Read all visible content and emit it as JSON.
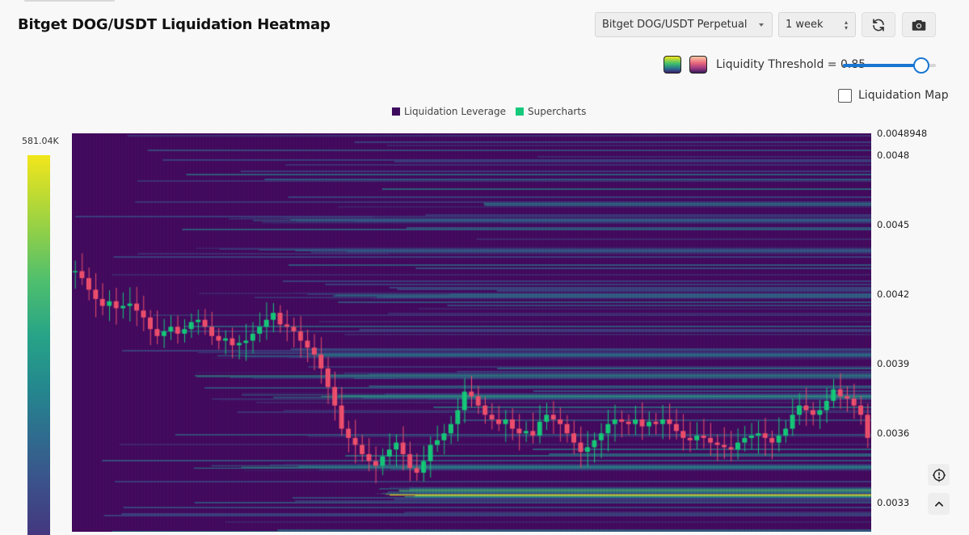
{
  "header": {
    "title": "Bitget DOG/USDT Liquidation Heatmap"
  },
  "controls": {
    "exchange_select": "Bitget DOG/USDT Perpetual",
    "range_select": "1 week",
    "refresh_icon": "refresh-icon",
    "camera_icon": "camera-icon",
    "threshold_label": "Liquidity Threshold = 0.85",
    "threshold_value": 0.85,
    "liquidation_map_label": "Liquidation Map",
    "liquidation_map_checked": false
  },
  "colorscales": [
    "viridis",
    "magma"
  ],
  "legend": [
    {
      "label": "Liquidation Leverage",
      "color": "#3d0b5e"
    },
    {
      "label": "Supercharts",
      "color": "#16c97a"
    }
  ],
  "colorbar": {
    "max_label": "581.04K"
  },
  "chart_data": {
    "type": "heatmap",
    "y_ticks": [
      "0.0048948",
      "0.0048",
      "0.0045",
      "0.0042",
      "0.0039",
      "0.0036",
      "0.0033"
    ],
    "y_range": [
      0.0031,
      0.0048948
    ],
    "price_candles_close": [
      0.0043,
      0.00427,
      0.00422,
      0.00418,
      0.00415,
      0.00417,
      0.00414,
      0.00415,
      0.00416,
      0.00413,
      0.0041,
      0.00405,
      0.00402,
      0.00404,
      0.00406,
      0.00403,
      0.00405,
      0.00408,
      0.00409,
      0.00406,
      0.00402,
      0.004,
      0.00401,
      0.00398,
      0.00399,
      0.004,
      0.00403,
      0.00406,
      0.00409,
      0.00412,
      0.00407,
      0.00406,
      0.00404,
      0.004,
      0.00397,
      0.00394,
      0.00388,
      0.0038,
      0.00372,
      0.00362,
      0.00358,
      0.00355,
      0.00351,
      0.00348,
      0.00346,
      0.0035,
      0.00353,
      0.00356,
      0.00351,
      0.00345,
      0.00343,
      0.00348,
      0.00355,
      0.00357,
      0.0036,
      0.00364,
      0.0037,
      0.00378,
      0.00376,
      0.00372,
      0.00368,
      0.00366,
      0.00364,
      0.00366,
      0.00362,
      0.0036,
      0.00361,
      0.00359,
      0.00365,
      0.00368,
      0.00366,
      0.00364,
      0.0036,
      0.00356,
      0.00352,
      0.00354,
      0.00357,
      0.0036,
      0.00364,
      0.00366,
      0.00365,
      0.00364,
      0.00366,
      0.00363,
      0.00365,
      0.00364,
      0.00366,
      0.00364,
      0.00361,
      0.00358,
      0.00357,
      0.00359,
      0.00358,
      0.00356,
      0.00355,
      0.00354,
      0.00353,
      0.00356,
      0.00358,
      0.00359,
      0.0036,
      0.00358,
      0.00356,
      0.00359,
      0.00362,
      0.00368,
      0.00372,
      0.0037,
      0.00368,
      0.0037,
      0.00374,
      0.00379,
      0.00376,
      0.00375,
      0.00372,
      0.00368,
      0.00358
    ],
    "high_liquidity_levels": [
      {
        "price": 0.003335,
        "intensity": 1.0
      },
      {
        "price": 0.003355,
        "intensity": 0.75
      },
      {
        "price": 0.003455,
        "intensity": 0.55
      },
      {
        "price": 0.00376,
        "intensity": 0.6
      },
      {
        "price": 0.00385,
        "intensity": 0.55
      },
      {
        "price": 0.00394,
        "intensity": 0.5
      },
      {
        "price": 0.004195,
        "intensity": 0.45
      },
      {
        "price": 0.00439,
        "intensity": 0.4
      },
      {
        "price": 0.00452,
        "intensity": 0.35
      }
    ]
  }
}
